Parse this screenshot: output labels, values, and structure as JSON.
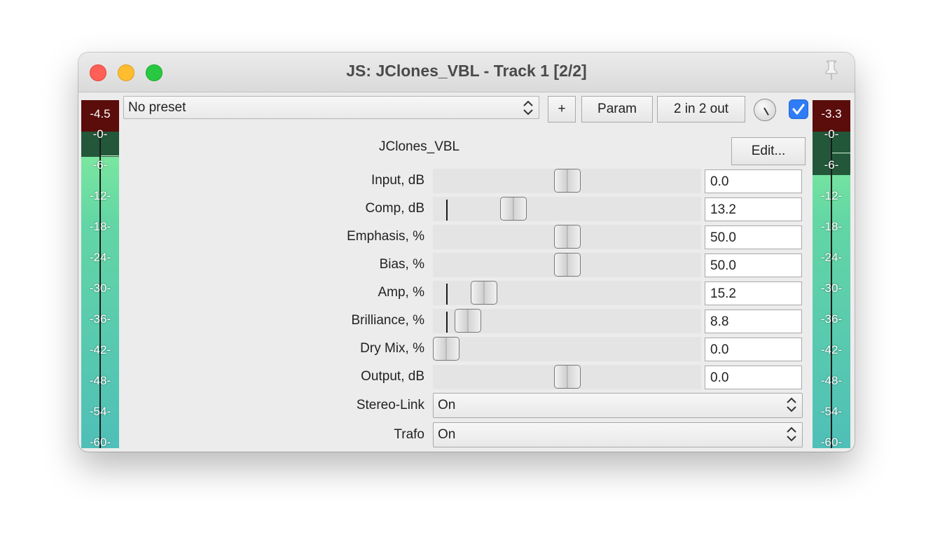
{
  "window": {
    "title": "JS: JClones_VBL - Track 1 [2/2]"
  },
  "meters": {
    "left": {
      "peak": "-4.5"
    },
    "right": {
      "peak": "-3.3"
    },
    "scale": [
      "-0-",
      "-6-",
      "-12-",
      "-18-",
      "-24-",
      "-30-",
      "-36-",
      "-42-",
      "-48-",
      "-54-",
      "-60-"
    ]
  },
  "toolbar": {
    "preset": "No preset",
    "add_label": "+",
    "param_label": "Param",
    "io_label": "2 in 2 out",
    "enabled": true
  },
  "plugin": {
    "name": "JClones_VBL",
    "edit_label": "Edit..."
  },
  "params": [
    {
      "label": "Input, dB",
      "value": "0.0",
      "position": 0.5,
      "zero": 0.5
    },
    {
      "label": "Comp, dB",
      "value": "13.2",
      "position": 0.3,
      "zero": 0.05
    },
    {
      "label": "Emphasis, %",
      "value": "50.0",
      "position": 0.5,
      "zero": 0.5
    },
    {
      "label": "Bias, %",
      "value": "50.0",
      "position": 0.5,
      "zero": 0.5
    },
    {
      "label": "Amp, %",
      "value": "15.2",
      "position": 0.19,
      "zero": 0.05
    },
    {
      "label": "Brilliance, %",
      "value": "8.8",
      "position": 0.13,
      "zero": 0.05
    },
    {
      "label": "Dry Mix, %",
      "value": "0.0",
      "position": 0.05,
      "zero": 0.05
    },
    {
      "label": "Output, dB",
      "value": "0.0",
      "position": 0.5,
      "zero": 0.5
    }
  ],
  "selects": [
    {
      "label": "Stereo-Link",
      "value": "On"
    },
    {
      "label": "Trafo",
      "value": "On"
    }
  ],
  "colors": {
    "meter_peak": "#5a0d0a",
    "meter_green": "#8ef59a",
    "meter_teal": "#4fbfb8",
    "checkbox": "#2f7cf6"
  }
}
